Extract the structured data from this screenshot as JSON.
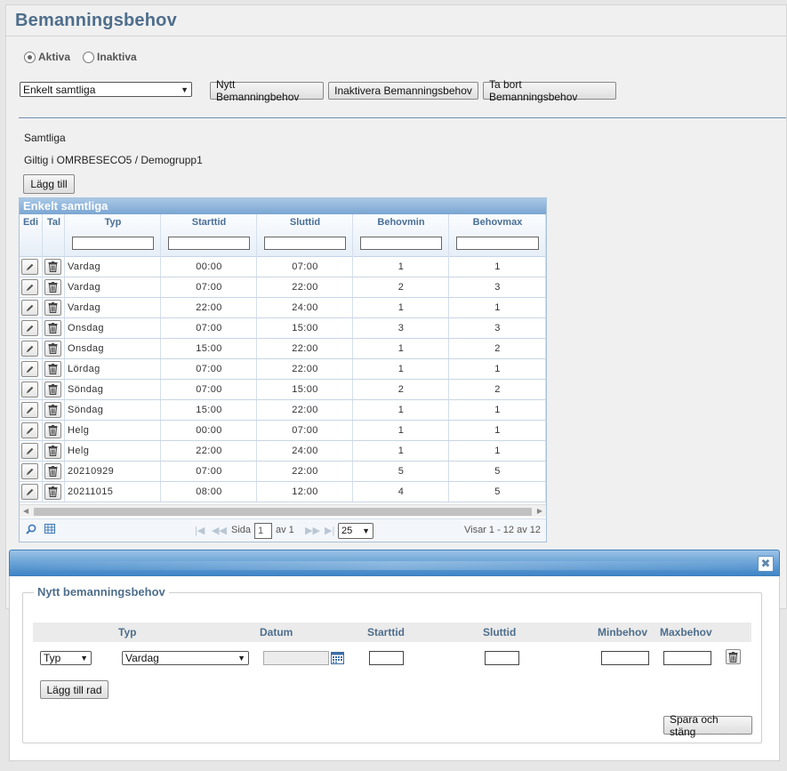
{
  "page": {
    "title": "Bemanningsbehov"
  },
  "filter": {
    "radio_active": "Aktiva",
    "radio_inactive": "Inaktiva",
    "selected": "active"
  },
  "toolbar": {
    "select_value": "Enkelt samtliga",
    "new_label": "Nytt Bemanningbehov",
    "deactivate_label": "Inaktivera Bemanningsbehov",
    "delete_label": "Ta bort Bemanningsbehov"
  },
  "info": {
    "line1": "Samtliga",
    "line2": "Giltig i OMRBESECO5 / Demogrupp1",
    "add_label": "Lägg till"
  },
  "grid": {
    "caption": "Enkelt samtliga",
    "columns": [
      "Edi",
      "Tal",
      "Typ",
      "Starttid",
      "Sluttid",
      "Behovmin",
      "Behovmax"
    ],
    "rows": [
      [
        "Vardag",
        "00:00",
        "07:00",
        "1",
        "1"
      ],
      [
        "Vardag",
        "07:00",
        "22:00",
        "2",
        "3"
      ],
      [
        "Vardag",
        "22:00",
        "24:00",
        "1",
        "1"
      ],
      [
        "Onsdag",
        "07:00",
        "15:00",
        "3",
        "3"
      ],
      [
        "Onsdag",
        "15:00",
        "22:00",
        "1",
        "2"
      ],
      [
        "Lördag",
        "07:00",
        "22:00",
        "1",
        "1"
      ],
      [
        "Söndag",
        "07:00",
        "15:00",
        "2",
        "2"
      ],
      [
        "Söndag",
        "15:00",
        "22:00",
        "1",
        "1"
      ],
      [
        "Helg",
        "00:00",
        "07:00",
        "1",
        "1"
      ],
      [
        "Helg",
        "22:00",
        "24:00",
        "1",
        "1"
      ],
      [
        "20210929",
        "07:00",
        "22:00",
        "5",
        "5"
      ],
      [
        "20211015",
        "08:00",
        "12:00",
        "4",
        "5"
      ]
    ],
    "pager": {
      "page_label": "Sida",
      "page": "1",
      "of_label": "av 1",
      "page_size": "25",
      "status": "Visar 1 - 12 av 12"
    }
  },
  "dialog": {
    "legend": "Nytt bemanningsbehov",
    "headers": {
      "typ": "Typ",
      "datum": "Datum",
      "starttid": "Starttid",
      "sluttid": "Sluttid",
      "minbehov": "Minbehov",
      "maxbehov": "Maxbehov"
    },
    "row": {
      "kind_select": "Typ",
      "day_select": "Vardag"
    },
    "add_row_label": "Lägg till rad",
    "save_label": "Spara och stäng"
  },
  "colors": {
    "title": "#4e6e8c",
    "header_text": "#4a6f97",
    "dialog_bar": "#6da5d8"
  }
}
